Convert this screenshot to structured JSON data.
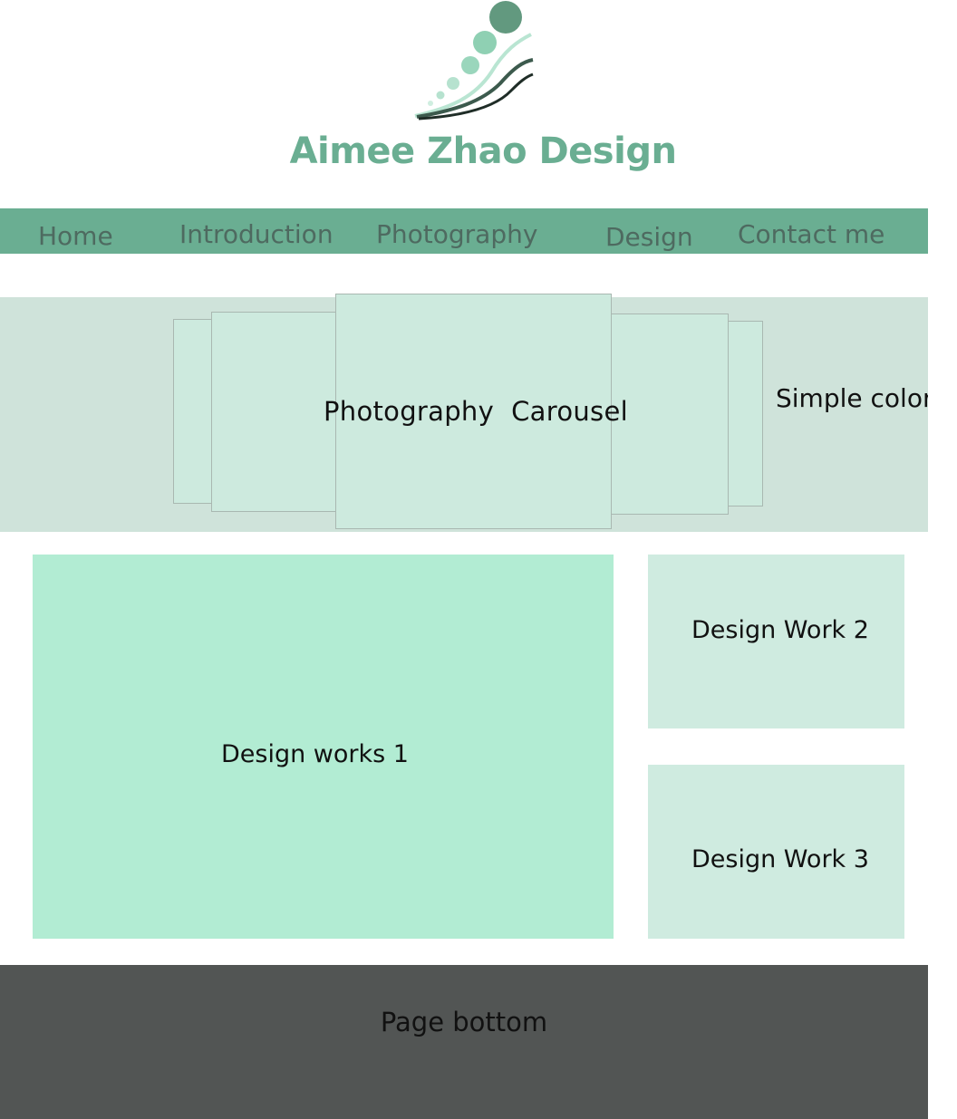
{
  "header": {
    "logo_icon": "swirl-dots-logo",
    "site_title": "Aimee Zhao Design",
    "brand_color": "#6aae92"
  },
  "nav": {
    "items": [
      {
        "label": "Home"
      },
      {
        "label": "Introduction"
      },
      {
        "label": "Photography"
      },
      {
        "label": "Design"
      },
      {
        "label": "Contact me"
      }
    ],
    "background": "#6aae92",
    "text_color": "#4e6a60"
  },
  "carousel": {
    "label": "Photography  Carousel",
    "side_note": "Simple color"
  },
  "works": {
    "main_label": "Design works 1",
    "second_label": "Design Work 2",
    "third_label": "Design Work 3"
  },
  "footer": {
    "label": "Page bottom",
    "background": "#525554"
  }
}
